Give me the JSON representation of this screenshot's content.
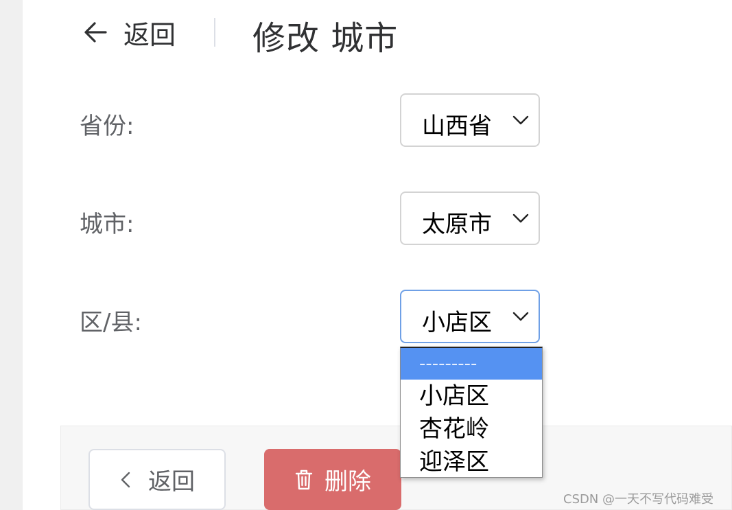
{
  "header": {
    "back_label": "返回",
    "title": "修改 城市"
  },
  "form": {
    "province": {
      "label": "省份:",
      "value": "山西省"
    },
    "city": {
      "label": "城市:",
      "value": "太原市"
    },
    "district": {
      "label": "区/县:",
      "value": "小店区"
    }
  },
  "district_dropdown": {
    "options": [
      "---------",
      "小店区",
      "杏花岭",
      "迎泽区"
    ],
    "highlighted_option": "---------"
  },
  "footer": {
    "back_label": "返回",
    "delete_label": "删除"
  },
  "watermark": "CSDN @一天不写代码难受",
  "colors": {
    "delete_button": "#d96c6c",
    "highlight": "#5592f2",
    "focus_border": "#6fa0e6"
  }
}
